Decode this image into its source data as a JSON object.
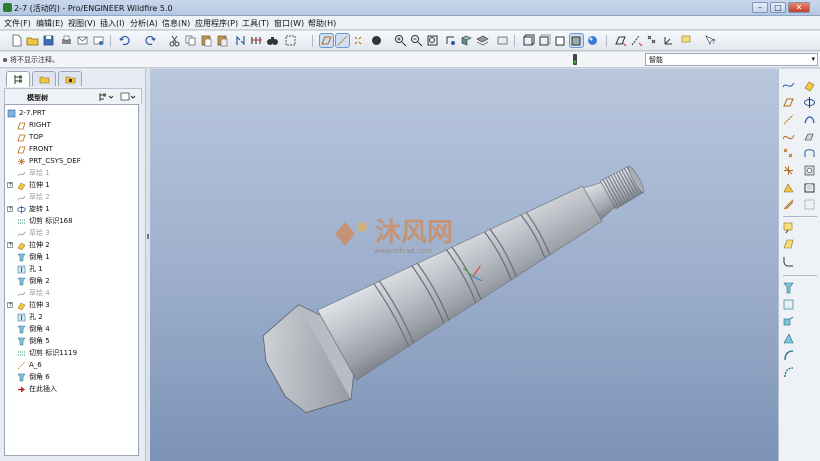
{
  "window": {
    "title": "2-7 (活动的) - Pro/ENGINEER Wildfire 5.0",
    "minimize": "–",
    "maximize": "□",
    "close": "✕"
  },
  "menu": [
    "文件(F)",
    "编辑(E)",
    "视图(V)",
    "插入(I)",
    "分析(A)",
    "信息(N)",
    "应用程序(P)",
    "工具(T)",
    "窗口(W)",
    "帮助(H)"
  ],
  "status": {
    "message": "将不显示注释。",
    "filter": "智能"
  },
  "model_tree": {
    "header": "模型树",
    "settings_icon": "tree-settings-icon",
    "show_icon": "tree-show-icon",
    "items": [
      {
        "label": "2-7.PRT",
        "icon": "part-icon",
        "expand": false,
        "suppressed": false,
        "level": 0
      },
      {
        "label": "RIGHT",
        "icon": "datum-plane-icon",
        "expand": false,
        "suppressed": false,
        "level": 1
      },
      {
        "label": "TOP",
        "icon": "datum-plane-icon",
        "expand": false,
        "suppressed": false,
        "level": 1
      },
      {
        "label": "FRONT",
        "icon": "datum-plane-icon",
        "expand": false,
        "suppressed": false,
        "level": 1
      },
      {
        "label": "PRT_CSYS_DEF",
        "icon": "csys-icon",
        "expand": false,
        "suppressed": false,
        "level": 1
      },
      {
        "label": "草绘 1",
        "icon": "sketch-icon",
        "expand": false,
        "suppressed": true,
        "level": 1
      },
      {
        "label": "拉伸 1",
        "icon": "extrude-icon",
        "expand": true,
        "suppressed": false,
        "level": 1
      },
      {
        "label": "草绘 2",
        "icon": "sketch-icon",
        "expand": false,
        "suppressed": true,
        "level": 1
      },
      {
        "label": "旋转 1",
        "icon": "revolve-icon",
        "expand": true,
        "suppressed": false,
        "level": 1
      },
      {
        "label": "切剪 标识168",
        "icon": "cut-icon",
        "expand": false,
        "suppressed": false,
        "level": 1
      },
      {
        "label": "草绘 3",
        "icon": "sketch-icon",
        "expand": false,
        "suppressed": true,
        "level": 1
      },
      {
        "label": "拉伸 2",
        "icon": "extrude-icon",
        "expand": true,
        "suppressed": false,
        "level": 1
      },
      {
        "label": "倒角 1",
        "icon": "chamfer-icon",
        "expand": false,
        "suppressed": false,
        "level": 1
      },
      {
        "label": "孔 1",
        "icon": "hole-icon",
        "expand": false,
        "suppressed": false,
        "level": 1
      },
      {
        "label": "倒角 2",
        "icon": "chamfer-icon",
        "expand": false,
        "suppressed": false,
        "level": 1
      },
      {
        "label": "草绘 4",
        "icon": "sketch-icon",
        "expand": false,
        "suppressed": true,
        "level": 1
      },
      {
        "label": "拉伸 3",
        "icon": "extrude-icon",
        "expand": true,
        "suppressed": false,
        "level": 1
      },
      {
        "label": "孔 2",
        "icon": "hole-icon",
        "expand": false,
        "suppressed": false,
        "level": 1
      },
      {
        "label": "倒角 4",
        "icon": "chamfer-icon",
        "expand": false,
        "suppressed": false,
        "level": 1
      },
      {
        "label": "倒角 5",
        "icon": "chamfer-icon",
        "expand": false,
        "suppressed": false,
        "level": 1
      },
      {
        "label": "切剪 标识1119",
        "icon": "cut-icon",
        "expand": false,
        "suppressed": false,
        "level": 1
      },
      {
        "label": "A_6",
        "icon": "axis-icon",
        "expand": false,
        "suppressed": false,
        "level": 1
      },
      {
        "label": "倒角 6",
        "icon": "chamfer-icon",
        "expand": false,
        "suppressed": false,
        "level": 1
      },
      {
        "label": "在此插入",
        "icon": "insert-arrow-icon",
        "expand": false,
        "suppressed": false,
        "level": 1
      }
    ]
  },
  "watermark": {
    "logo_text": "沐风网",
    "url_text": "www.mfcad.com"
  },
  "colors": {
    "viewport_top": "#b9c7dd",
    "viewport_bottom": "#7d92b6",
    "model_gray": "#b7bcc3",
    "watermark_orange": "#e07a2c"
  }
}
